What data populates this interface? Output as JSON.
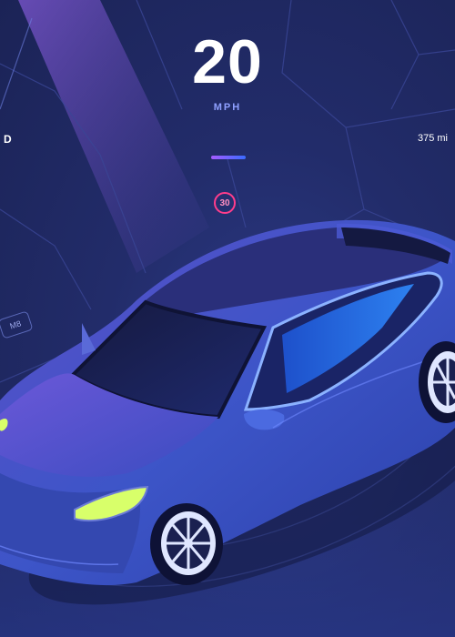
{
  "dashboard": {
    "speed": "20",
    "speed_unit": "MPH",
    "gear": "D",
    "range": "375 mi",
    "speed_limit": "30",
    "route_label": "M8"
  },
  "colors": {
    "background": "#222c6a",
    "accent_purple": "#a55cff",
    "accent_blue": "#3a6bff",
    "speed_limit_ring": "#ff3d8b",
    "car_body": "#3b4fc2",
    "headlight": "#d8ff6a"
  }
}
